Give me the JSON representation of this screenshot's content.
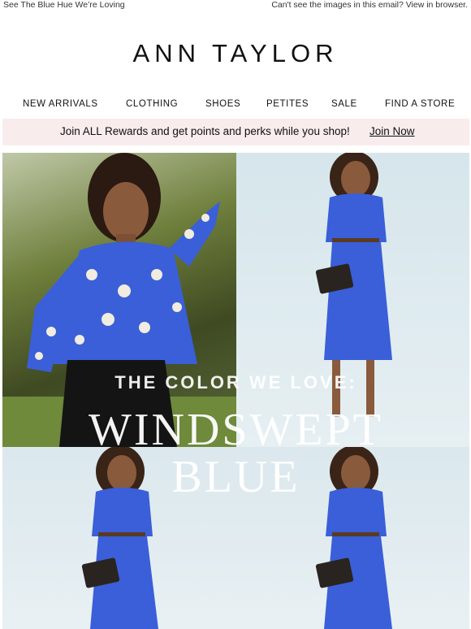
{
  "preheader": {
    "left_text": "See The Blue Hue We’re Loving",
    "right_text": "Can't see the images in this email? View in browser."
  },
  "brand": {
    "logo_text": "ANN TAYLOR"
  },
  "nav": {
    "items": [
      "NEW ARRIVALS",
      "CLOTHING",
      "SHOES",
      "PETITES",
      "SALE",
      "FIND A STORE"
    ]
  },
  "rewards_banner": {
    "message": "Join ALL Rewards and get points and perks while you shop!",
    "link_label": "Join Now",
    "background": "#f8ecec"
  },
  "hero": {
    "headline": "THE COLOR WE LOVE:",
    "title_line1": "WINDSWEPT",
    "title_line2": "BLUE",
    "accent_color": "#3a5fd8"
  }
}
